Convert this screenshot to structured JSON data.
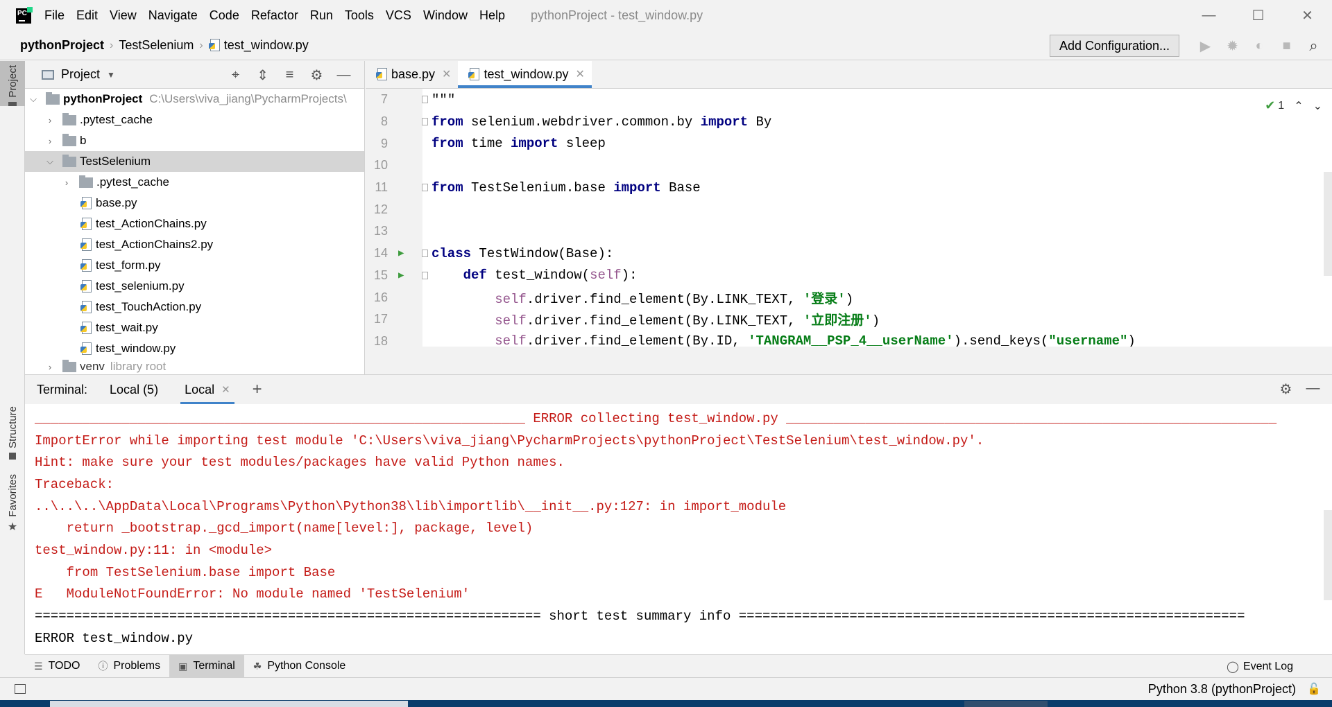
{
  "window": {
    "title": "pythonProject - test_window.py",
    "menu": [
      "File",
      "Edit",
      "View",
      "Navigate",
      "Code",
      "Refactor",
      "Run",
      "Tools",
      "VCS",
      "Window",
      "Help"
    ],
    "logo_text": "PC"
  },
  "navbar": {
    "breadcrumbs": [
      "pythonProject",
      "TestSelenium",
      "test_window.py"
    ],
    "add_config_label": "Add Configuration..."
  },
  "left_stripe": {
    "tabs": [
      "Project",
      "Structure",
      "Favorites"
    ]
  },
  "project_panel": {
    "title": "Project",
    "root": {
      "name": "pythonProject",
      "path": "C:\\Users\\viva_jiang\\PycharmProjects\\"
    },
    "items": [
      {
        "name": ".pytest_cache",
        "kind": "folder",
        "depth": 1,
        "expanded": false
      },
      {
        "name": "b",
        "kind": "folder",
        "depth": 1,
        "expanded": false
      },
      {
        "name": "TestSelenium",
        "kind": "folder",
        "depth": 1,
        "expanded": true,
        "selected": true
      },
      {
        "name": ".pytest_cache",
        "kind": "folder",
        "depth": 2,
        "expanded": false
      },
      {
        "name": "base.py",
        "kind": "file",
        "depth": 2
      },
      {
        "name": "test_ActionChains.py",
        "kind": "file",
        "depth": 2
      },
      {
        "name": "test_ActionChains2.py",
        "kind": "file",
        "depth": 2
      },
      {
        "name": "test_form.py",
        "kind": "file",
        "depth": 2
      },
      {
        "name": "test_selenium.py",
        "kind": "file",
        "depth": 2
      },
      {
        "name": "test_TouchAction.py",
        "kind": "file",
        "depth": 2
      },
      {
        "name": "test_wait.py",
        "kind": "file",
        "depth": 2
      },
      {
        "name": "test_window.py",
        "kind": "file",
        "depth": 2
      }
    ],
    "venv": {
      "name": "venv",
      "note": "library root"
    }
  },
  "editor": {
    "tabs": [
      {
        "label": "base.py",
        "active": false
      },
      {
        "label": "test_window.py",
        "active": true
      }
    ],
    "inspection_count": "1",
    "lines": [
      {
        "n": "7",
        "text": "\"\"\""
      },
      {
        "n": "8",
        "text": "from selenium.webdriver.common.by import By"
      },
      {
        "n": "9",
        "text": "from time import sleep"
      },
      {
        "n": "10",
        "text": ""
      },
      {
        "n": "11",
        "text": "from TestSelenium.base import Base"
      },
      {
        "n": "12",
        "text": ""
      },
      {
        "n": "13",
        "text": ""
      },
      {
        "n": "14",
        "text": "class TestWindow(Base):"
      },
      {
        "n": "15",
        "text": "    def test_window(self):"
      },
      {
        "n": "16",
        "text": "        self.driver.find_element(By.LINK_TEXT, '登录')"
      },
      {
        "n": "17",
        "text": "        self.driver.find_element(By.LINK_TEXT, '立即注册')"
      },
      {
        "n": "18",
        "text": "        self.driver.find_element(By.ID, 'TANGRAM__PSP_4__userName').send_keys(\"username\")"
      }
    ]
  },
  "terminal": {
    "label": "Terminal:",
    "tabs": [
      {
        "label": "Local (5)",
        "active": false
      },
      {
        "label": "Local",
        "active": true
      }
    ],
    "lines": [
      {
        "text": "______________________________________________________________ ERROR collecting test_window.py ______________________________________________________________",
        "color": "red"
      },
      {
        "text": "ImportError while importing test module 'C:\\Users\\viva_jiang\\PycharmProjects\\pythonProject\\TestSelenium\\test_window.py'.",
        "color": "red"
      },
      {
        "text": "Hint: make sure your test modules/packages have valid Python names.",
        "color": "red"
      },
      {
        "text": "Traceback:",
        "color": "red"
      },
      {
        "text": "..\\..\\..\\AppData\\Local\\Programs\\Python\\Python38\\lib\\importlib\\__init__.py:127: in import_module",
        "color": "red"
      },
      {
        "text": "    return _bootstrap._gcd_import(name[level:], package, level)",
        "color": "red"
      },
      {
        "text": "test_window.py:11: in <module>",
        "color": "red"
      },
      {
        "text": "    from TestSelenium.base import Base",
        "color": "red"
      },
      {
        "text": "E   ModuleNotFoundError: No module named 'TestSelenium'",
        "color": "red"
      },
      {
        "text": "================================================================ short test summary info ================================================================",
        "color": "black"
      },
      {
        "text": "ERROR test_window.py",
        "color": "black"
      }
    ]
  },
  "bottom_tools": [
    {
      "label": "TODO",
      "icon": "todo-list-icon",
      "active": false
    },
    {
      "label": "Problems",
      "icon": "problems-icon",
      "active": false
    },
    {
      "label": "Terminal",
      "icon": "terminal-icon",
      "active": true
    },
    {
      "label": "Python Console",
      "icon": "python-console-icon",
      "active": false
    }
  ],
  "event_log_label": "Event Log",
  "status": {
    "interpreter": "Python 3.8 (pythonProject)"
  },
  "colors": {
    "error_text": "#c41a16",
    "keyword": "#000080",
    "string": "#067d17",
    "self": "#94558d",
    "accent": "#4083c9"
  }
}
